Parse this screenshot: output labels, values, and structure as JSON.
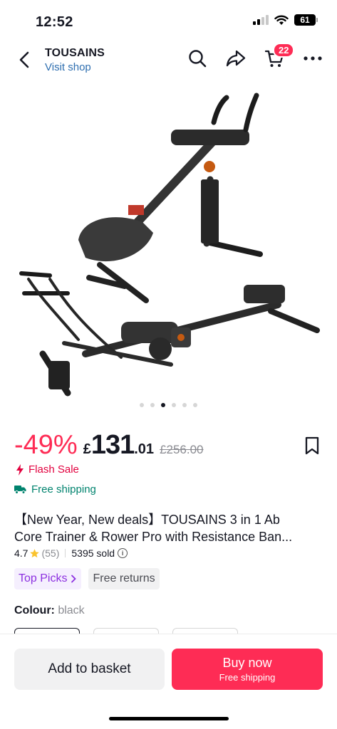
{
  "status": {
    "time": "12:52",
    "battery": "61"
  },
  "header": {
    "shop_name": "TOUSAINS",
    "visit_shop": "Visit shop",
    "cart_count": "22"
  },
  "gallery": {
    "total": 6,
    "active_index": 2
  },
  "price": {
    "discount": "-49%",
    "currency": "£",
    "integer": "131",
    "decimal": ".01",
    "original": "£256.00"
  },
  "promotions": {
    "flash_sale": "Flash Sale",
    "free_shipping": "Free shipping"
  },
  "product": {
    "title_line1": "【New Year, New deals】TOUSAINS 3 in 1 Ab",
    "title_line2": "Core Trainer & Rower Pro with Resistance Ban...",
    "rating": "4.7",
    "review_count": "(55)",
    "sold": "5395 sold"
  },
  "tags": {
    "top_picks": "Top Picks",
    "free_returns": "Free returns"
  },
  "variant": {
    "label": "Colour:",
    "value": "black"
  },
  "actions": {
    "add_to_basket": "Add to basket",
    "buy_now": "Buy now",
    "buy_now_sub": "Free shipping"
  },
  "colors": {
    "accent": "#fe2c55",
    "flash": "#e2003e",
    "shipping": "#00836e",
    "link": "#2f6fb0",
    "top_picks": "#8c2fe0"
  }
}
